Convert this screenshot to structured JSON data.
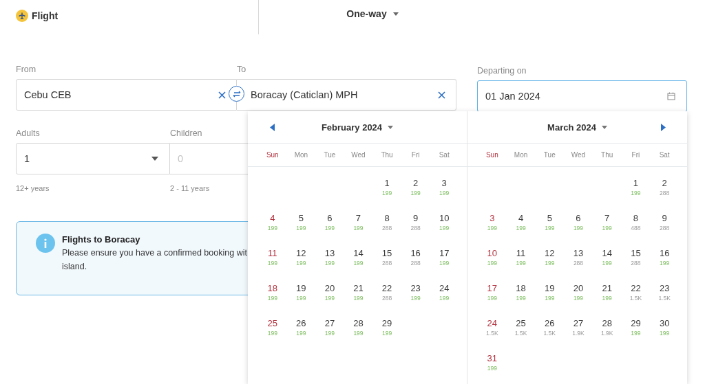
{
  "header": {
    "product": "Flight",
    "trip_type": "One-way"
  },
  "from": {
    "label": "From",
    "value": "Cebu CEB"
  },
  "to": {
    "label": "To",
    "value": "Boracay (Caticlan) MPH"
  },
  "departing": {
    "label": "Departing on",
    "value": "01 Jan 2024",
    "focused": true
  },
  "adults": {
    "label": "Adults",
    "value": "1",
    "hint": "12+ years"
  },
  "children": {
    "label": "Children",
    "placeholder": "0",
    "hint": "2 - 11 years"
  },
  "notice": {
    "title": "Flights to Boracay",
    "body_lines": [
      "Please ensure you have a confirmed booking wit",
      "island."
    ]
  },
  "calendar": {
    "months": [
      {
        "title": "February 2024",
        "kind": "first",
        "weekdays": [
          "Sun",
          "Mon",
          "Tue",
          "Wed",
          "Thu",
          "Fri",
          "Sat"
        ],
        "weeks": [
          [
            {
              "kind": "blank"
            },
            {
              "kind": "blank"
            },
            {
              "kind": "blank"
            },
            {
              "kind": "blank"
            },
            {
              "kind": "day",
              "day": "1",
              "price": "199",
              "lowest": true
            },
            {
              "kind": "day",
              "day": "2",
              "price": "199",
              "lowest": true
            },
            {
              "kind": "day",
              "day": "3",
              "price": "199",
              "lowest": true
            }
          ],
          [
            {
              "kind": "day",
              "day": "4",
              "price": "199",
              "lowest": true
            },
            {
              "kind": "day",
              "day": "5",
              "price": "199",
              "lowest": true
            },
            {
              "kind": "day",
              "day": "6",
              "price": "199",
              "lowest": true
            },
            {
              "kind": "day",
              "day": "7",
              "price": "199",
              "lowest": true
            },
            {
              "kind": "day",
              "day": "8",
              "price": "288",
              "lowest": false
            },
            {
              "kind": "day",
              "day": "9",
              "price": "288",
              "lowest": false
            },
            {
              "kind": "day",
              "day": "10",
              "price": "199",
              "lowest": true
            }
          ],
          [
            {
              "kind": "day",
              "day": "11",
              "price": "199",
              "lowest": true
            },
            {
              "kind": "day",
              "day": "12",
              "price": "199",
              "lowest": true
            },
            {
              "kind": "day",
              "day": "13",
              "price": "199",
              "lowest": true
            },
            {
              "kind": "day",
              "day": "14",
              "price": "199",
              "lowest": true
            },
            {
              "kind": "day",
              "day": "15",
              "price": "288",
              "lowest": false
            },
            {
              "kind": "day",
              "day": "16",
              "price": "288",
              "lowest": false
            },
            {
              "kind": "day",
              "day": "17",
              "price": "199",
              "lowest": true
            }
          ],
          [
            {
              "kind": "day",
              "day": "18",
              "price": "199",
              "lowest": true
            },
            {
              "kind": "day",
              "day": "19",
              "price": "199",
              "lowest": true
            },
            {
              "kind": "day",
              "day": "20",
              "price": "199",
              "lowest": true
            },
            {
              "kind": "day",
              "day": "21",
              "price": "199",
              "lowest": true
            },
            {
              "kind": "day",
              "day": "22",
              "price": "288",
              "lowest": false
            },
            {
              "kind": "day",
              "day": "23",
              "price": "199",
              "lowest": true
            },
            {
              "kind": "day",
              "day": "24",
              "price": "199",
              "lowest": true
            }
          ],
          [
            {
              "kind": "day",
              "day": "25",
              "price": "199",
              "lowest": true
            },
            {
              "kind": "day",
              "day": "26",
              "price": "199",
              "lowest": true
            },
            {
              "kind": "day",
              "day": "27",
              "price": "199",
              "lowest": true
            },
            {
              "kind": "day",
              "day": "28",
              "price": "199",
              "lowest": true
            },
            {
              "kind": "day",
              "day": "29",
              "price": "199",
              "lowest": true
            }
          ]
        ]
      },
      {
        "title": "March 2024",
        "kind": "last",
        "weekdays": [
          "Sun",
          "Mon",
          "Tue",
          "Wed",
          "Thu",
          "Fri",
          "Sat"
        ],
        "weeks": [
          [
            {
              "kind": "blank"
            },
            {
              "kind": "blank"
            },
            {
              "kind": "blank"
            },
            {
              "kind": "blank"
            },
            {
              "kind": "blank"
            },
            {
              "kind": "day",
              "day": "1",
              "price": "199",
              "lowest": true
            },
            {
              "kind": "day",
              "day": "2",
              "price": "288",
              "lowest": false
            }
          ],
          [
            {
              "kind": "day",
              "day": "3",
              "price": "199",
              "lowest": true
            },
            {
              "kind": "day",
              "day": "4",
              "price": "199",
              "lowest": true
            },
            {
              "kind": "day",
              "day": "5",
              "price": "199",
              "lowest": true
            },
            {
              "kind": "day",
              "day": "6",
              "price": "199",
              "lowest": true
            },
            {
              "kind": "day",
              "day": "7",
              "price": "199",
              "lowest": true
            },
            {
              "kind": "day",
              "day": "8",
              "price": "488",
              "lowest": false
            },
            {
              "kind": "day",
              "day": "9",
              "price": "288",
              "lowest": false
            }
          ],
          [
            {
              "kind": "day",
              "day": "10",
              "price": "199",
              "lowest": true
            },
            {
              "kind": "day",
              "day": "11",
              "price": "199",
              "lowest": true
            },
            {
              "kind": "day",
              "day": "12",
              "price": "199",
              "lowest": true
            },
            {
              "kind": "day",
              "day": "13",
              "price": "288",
              "lowest": false
            },
            {
              "kind": "day",
              "day": "14",
              "price": "199",
              "lowest": true
            },
            {
              "kind": "day",
              "day": "15",
              "price": "288",
              "lowest": false
            },
            {
              "kind": "day",
              "day": "16",
              "price": "199",
              "lowest": true
            }
          ],
          [
            {
              "kind": "day",
              "day": "17",
              "price": "199",
              "lowest": true
            },
            {
              "kind": "day",
              "day": "18",
              "price": "199",
              "lowest": true
            },
            {
              "kind": "day",
              "day": "19",
              "price": "199",
              "lowest": true
            },
            {
              "kind": "day",
              "day": "20",
              "price": "199",
              "lowest": true
            },
            {
              "kind": "day",
              "day": "21",
              "price": "199",
              "lowest": true
            },
            {
              "kind": "day",
              "day": "22",
              "price": "1.5K",
              "lowest": false
            },
            {
              "kind": "day",
              "day": "23",
              "price": "1.5K",
              "lowest": false
            }
          ],
          [
            {
              "kind": "day",
              "day": "24",
              "price": "1.5K",
              "lowest": false
            },
            {
              "kind": "day",
              "day": "25",
              "price": "1.5K",
              "lowest": false
            },
            {
              "kind": "day",
              "day": "26",
              "price": "1.5K",
              "lowest": false
            },
            {
              "kind": "day",
              "day": "27",
              "price": "1.9K",
              "lowest": false
            },
            {
              "kind": "day",
              "day": "28",
              "price": "1.9K",
              "lowest": false
            },
            {
              "kind": "day",
              "day": "29",
              "price": "199",
              "lowest": true
            },
            {
              "kind": "day",
              "day": "30",
              "price": "199",
              "lowest": true
            }
          ],
          [
            {
              "kind": "day",
              "day": "31",
              "price": "199",
              "lowest": true
            }
          ]
        ]
      }
    ]
  }
}
